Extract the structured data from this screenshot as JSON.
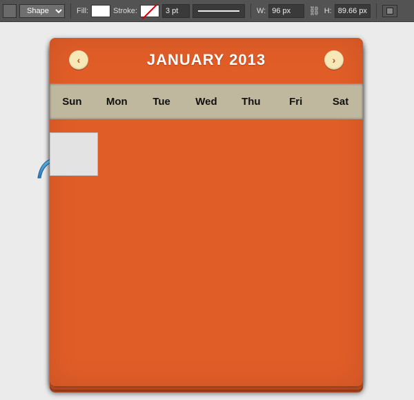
{
  "options_bar": {
    "tool_mode": "Shape",
    "fill_label": "Fill:",
    "stroke_label": "Stroke:",
    "stroke_weight": "3 pt",
    "width_label": "W:",
    "width_value": "96 px",
    "height_label": "H:",
    "height_value": "89.66 px"
  },
  "calendar": {
    "title": "JANUARY 2013",
    "prev_glyph": "‹",
    "next_glyph": "›",
    "days": [
      "Sun",
      "Mon",
      "Tue",
      "Wed",
      "Thu",
      "Fri",
      "Sat"
    ]
  }
}
